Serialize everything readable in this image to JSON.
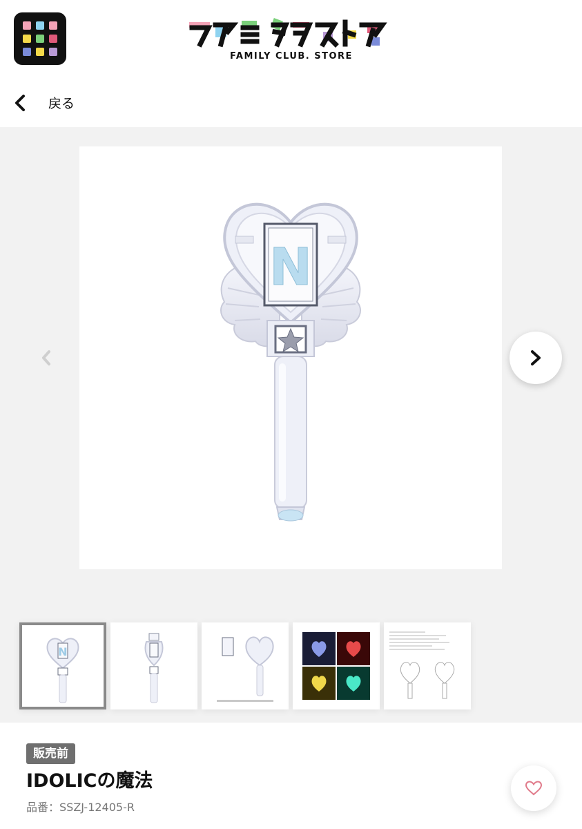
{
  "header": {
    "menu_icon": "grid-menu-icon",
    "menu_dot_colors": [
      "#f4a3b7",
      "#8fd3f0",
      "#f4a3b7",
      "#f3d94a",
      "#7bd07b",
      "#e05a7a",
      "#7a8bd9",
      "#f3d94a",
      "#b99ad6"
    ],
    "logo_text": "ファミクラストア",
    "logo_sub": "FAMILY CLUB. STORE"
  },
  "nav": {
    "back_label": "戻る",
    "back_icon": "chevron-left-icon"
  },
  "gallery": {
    "prev_icon": "chevron-left-icon",
    "next_icon": "chevron-right-icon",
    "main_image": "penlight-heart-wings-image",
    "thumbnails": [
      {
        "name": "penlight-front",
        "selected": true
      },
      {
        "name": "penlight-side",
        "selected": false
      },
      {
        "name": "penlight-parts",
        "selected": false
      },
      {
        "name": "penlight-colors",
        "selected": false
      },
      {
        "name": "penlight-instructions",
        "selected": false
      }
    ],
    "colors_thumb_tints": [
      "#5a6ad0",
      "#d02a2a",
      "#e0c22a",
      "#2ad0b0"
    ]
  },
  "product": {
    "badge": "販売前",
    "title": "IDOLICの魔法",
    "code": "品番：SSZJ-12405-R",
    "favorite_icon": "heart-outline-icon"
  },
  "colors": {
    "badge_bg": "#6f6f6f",
    "gallery_bg": "#f2f2f2",
    "heart": "#e07a8a"
  }
}
